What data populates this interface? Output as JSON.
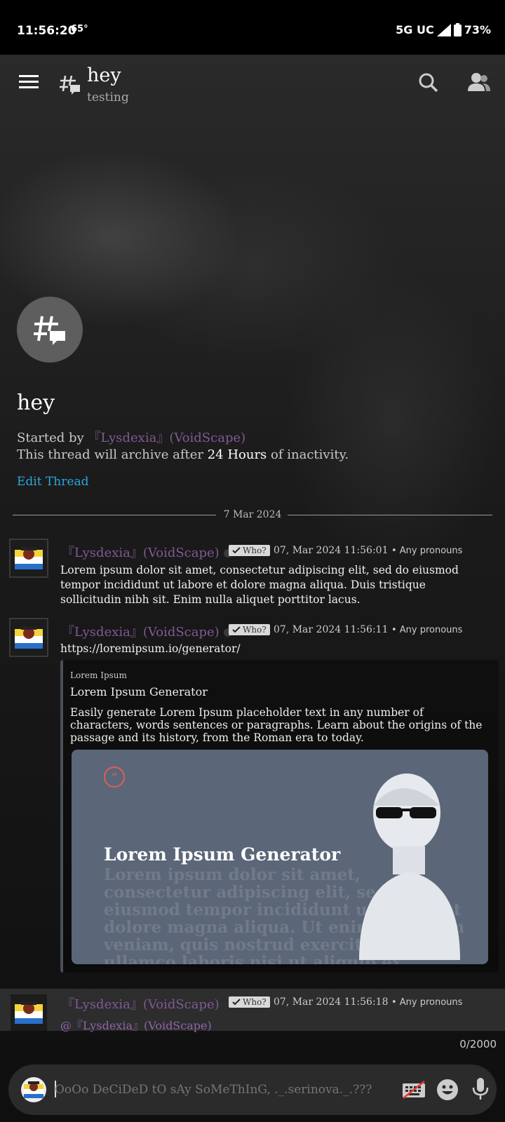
{
  "status_bar": {
    "time": "11:56:20",
    "temp": "65°",
    "network": "5G UC",
    "battery": "73%"
  },
  "app_bar": {
    "title": "hey",
    "subtitle": "testing"
  },
  "thread": {
    "title": "hey",
    "started_by_label": "Started by",
    "started_by_user": "『Lysdexia』(VoidScape)",
    "archive_prefix": "This thread will archive after",
    "archive_duration": "24 Hours",
    "archive_suffix": "of inactivity.",
    "edit_label": "Edit Thread"
  },
  "date_separator": "7 Mar 2024",
  "messages": [
    {
      "author": "『Lysdexia』(VoidScape)",
      "badge": "Who?",
      "timestamp": "07, Mar 2024 11:56:01",
      "pronouns": "• Any pronouns",
      "body": "Lorem ipsum dolor sit amet, consectetur adipiscing elit, sed do eiusmod tempor incididunt ut labore et dolore magna aliqua. Duis tristique sollicitudin nibh sit. Enim nulla aliquet porttitor lacus."
    },
    {
      "author": "『Lysdexia』(VoidScape)",
      "badge": "Who?",
      "timestamp": "07, Mar 2024 11:56:11",
      "pronouns": "• Any pronouns",
      "body": "https://loremipsum.io/generator/",
      "embed": {
        "provider": "Lorem Ipsum",
        "title": "Lorem Ipsum Generator",
        "description": "Easily generate Lorem Ipsum placeholder text in any number of characters, words sentences or paragraphs. Learn about the origins of the passage and its history, from the Roman era to today.",
        "image_title": "Lorem Ipsum Generator",
        "image_text": "Lorem ipsum dolor sit amet, consectetur adipiscing elit, sed do eiusmod tempor incididunt ut labore et dolore magna aliqua. Ut enim ad minim veniam, quis nostrud exercitation ullamco laboris nisi ut aliquip ex"
      }
    },
    {
      "author": "『Lysdexia』(VoidScape)",
      "badge": "Who?",
      "timestamp": "07, Mar 2024 11:56:18",
      "pronouns": "• Any pronouns",
      "mention": "@『Lysdexia』(VoidScape)"
    }
  ],
  "composer": {
    "counter": "0/2000",
    "placeholder": "OoOo DeCiDeD tO sAy SoMeThInG, ._.serinova._.???"
  },
  "colors": {
    "accent_link": "#2aa7e0",
    "username": "#7e5a93",
    "mention": "#8f65a8"
  },
  "icons": [
    "menu-icon",
    "thread-icon",
    "search-icon",
    "members-icon",
    "check-icon",
    "quote-icon",
    "keyboard-off-icon",
    "emoji-icon",
    "microphone-icon"
  ]
}
